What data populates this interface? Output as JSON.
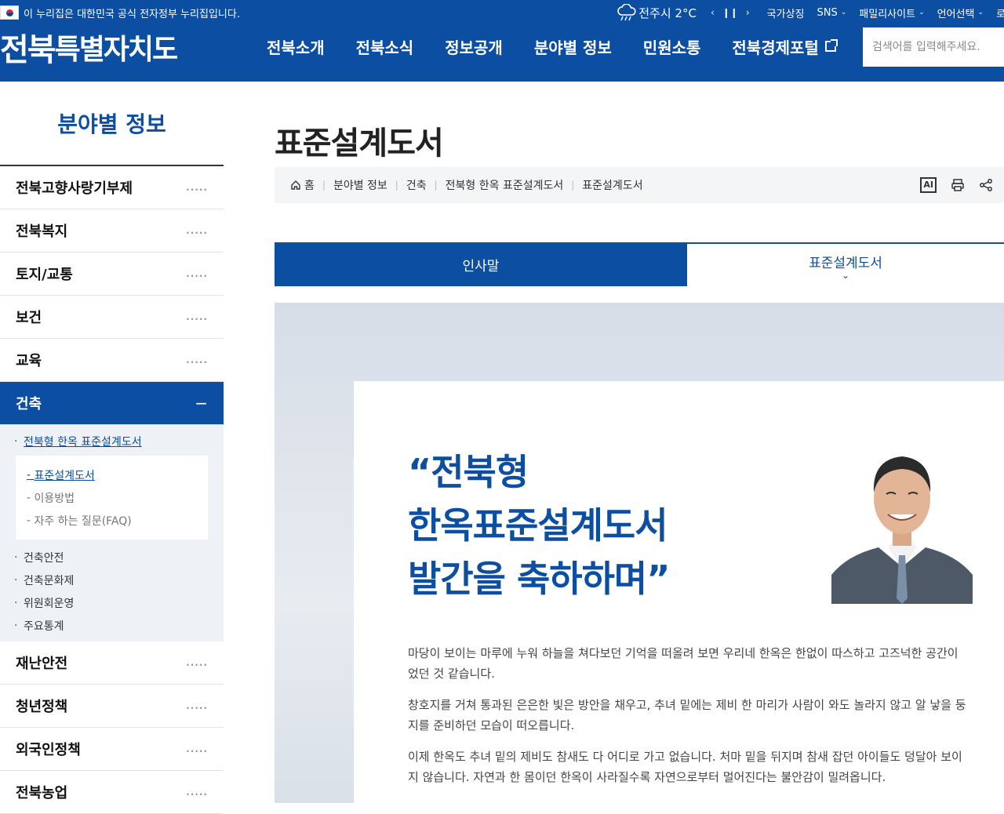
{
  "header": {
    "gov_notice": "이 누리집은 대한민국 공식 전자정부 누리집입니다.",
    "weather": "전주시 2°C",
    "utility": [
      "국가상징",
      "SNS",
      "패밀리사이트",
      "언어선택"
    ],
    "utility_cut": "로",
    "logo_part1": "전북",
    "logo_part2": "특별자치도",
    "nav": [
      "전북소개",
      "전북소식",
      "정보공개",
      "분야별 정보",
      "민원소통",
      "전북경제포털"
    ],
    "search_placeholder": "검색어를 입력해주세요."
  },
  "lnb": {
    "title": "분야별 정보",
    "items_top": [
      "전북고향사랑기부제",
      "전북복지",
      "토지/교통",
      "보건",
      "교육"
    ],
    "active": "건축",
    "sub_active": "전북형 한옥 표준설계도서",
    "sub_children": [
      "표준설계도서",
      "이용방법",
      "자주 하는 질문(FAQ)"
    ],
    "sub_other": [
      "건축안전",
      "건축문화제",
      "위원회운영",
      "주요통계"
    ],
    "items_bottom": [
      "재난안전",
      "청년정책",
      "외국인정책",
      "전북농업"
    ],
    "dots": "....."
  },
  "content": {
    "title": "표준설계도서",
    "breadcrumb": [
      "홈",
      "분야별 정보",
      "건축",
      "전북형 한옥 표준설계도서",
      "표준설계도서"
    ],
    "ai_label": "AI",
    "tabs": [
      "인사말",
      "표준설계도서"
    ],
    "greeting": [
      "“전북형",
      "한옥표준설계도서",
      "발간을 축하하며”"
    ],
    "paragraphs": [
      "마당이 보이는 마루에 누워 하늘을 쳐다보던 기억을 떠올려 보면 우리네 한옥은 한없이 따스하고 고즈넉한 공간이었던 것 같습니다.",
      "창호지를 거쳐 통과된 은은한 빛은 방안을 채우고, 추녀 밑에는 제비 한 마리가 사람이 와도 놀라지 않고 알 낳을 둥지를 준비하던 모습이 떠오릅니다.",
      "이제 한옥도 추녀 밑의 제비도 참새도 다 어디로 가고 없습니다. 처마 밑을 뒤지며 참새 잡던 아이들도 덩달아 보이지 않습니다. 자연과 한 몸이던 한옥이 사라질수록 자연으로부터 멀어진다는 불안감이 밀려옵니다."
    ]
  },
  "colors": {
    "brand": "#0b4ea2",
    "bg_gray": "#f4f5f7"
  }
}
